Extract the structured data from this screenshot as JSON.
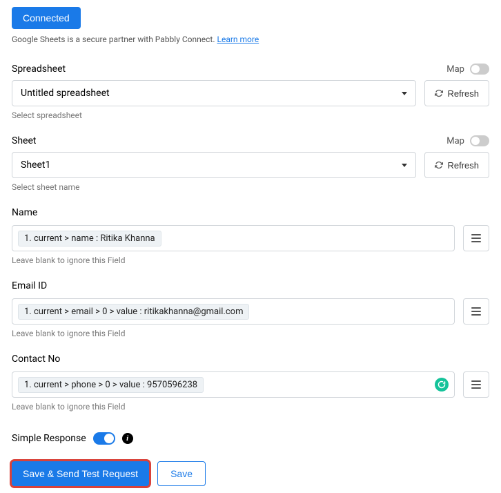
{
  "header": {
    "connected_button": "Connected",
    "partner_text": "Google Sheets is a secure partner with Pabbly Connect. ",
    "learn_more": "Learn more"
  },
  "spreadsheet": {
    "label": "Spreadsheet",
    "map_label": "Map",
    "value": "Untitled spreadsheet",
    "refresh": "Refresh",
    "hint": "Select spreadsheet"
  },
  "sheet": {
    "label": "Sheet",
    "map_label": "Map",
    "value": "Sheet1",
    "refresh": "Refresh",
    "hint": "Select sheet name"
  },
  "name_field": {
    "label": "Name",
    "token": "1. current > name : Ritika Khanna",
    "hint": "Leave blank to ignore this Field"
  },
  "email_field": {
    "label": "Email ID",
    "token": "1. current > email > 0 > value : ritikakhanna@gmail.com",
    "hint": "Leave blank to ignore this Field"
  },
  "contact_field": {
    "label": "Contact No",
    "token": "1. current > phone > 0 > value : 9570596238",
    "hint": "Leave blank to ignore this Field"
  },
  "simple_response": {
    "label": "Simple Response"
  },
  "buttons": {
    "primary": "Save & Send Test Request",
    "secondary": "Save"
  }
}
